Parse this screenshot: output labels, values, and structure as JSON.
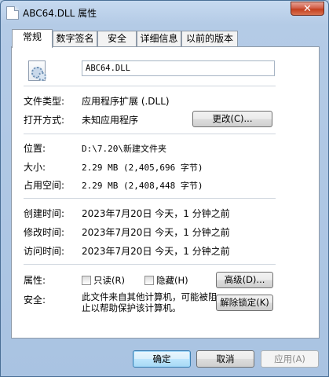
{
  "window": {
    "title": "ABC64.DLL 属性",
    "close_glyph": "✕"
  },
  "tabs": [
    {
      "label": "常规",
      "active": true
    },
    {
      "label": "数字签名",
      "active": false
    },
    {
      "label": "安全",
      "active": false
    },
    {
      "label": "详细信息",
      "active": false
    },
    {
      "label": "以前的版本",
      "active": false
    }
  ],
  "general": {
    "file_name": "ABC64.DLL",
    "file_icon": "dll-file-icon",
    "file_type_label": "文件类型:",
    "file_type_value": "应用程序扩展 (.DLL)",
    "opens_with_label": "打开方式:",
    "opens_with_value": "未知应用程序",
    "change_button": "更改(C)...",
    "location_label": "位置:",
    "location_value": "D:\\7.20\\新建文件夹",
    "size_label": "大小:",
    "size_value": "2.29 MB (2,405,696 字节)",
    "size_on_disk_label": "占用空间:",
    "size_on_disk_value": "2.29 MB (2,408,448 字节)",
    "created_label": "创建时间:",
    "created_value": "2023年7月20日 今天，1 分钟之前",
    "modified_label": "修改时间:",
    "modified_value": "2023年7月20日 今天，1 分钟之前",
    "accessed_label": "访问时间:",
    "accessed_value": "2023年7月20日 今天，1 分钟之前",
    "attributes_label": "属性:",
    "readonly_label": "只读(R)",
    "readonly_checked": false,
    "hidden_label": "隐藏(H)",
    "hidden_checked": false,
    "advanced_button": "高级(D)...",
    "security_label": "安全:",
    "security_text": "此文件来自其他计算机，可能被阻止以帮助保护该计算机。",
    "unblock_button": "解除锁定(K)"
  },
  "footer": {
    "ok": "确定",
    "cancel": "取消",
    "apply": "应用(A)"
  }
}
